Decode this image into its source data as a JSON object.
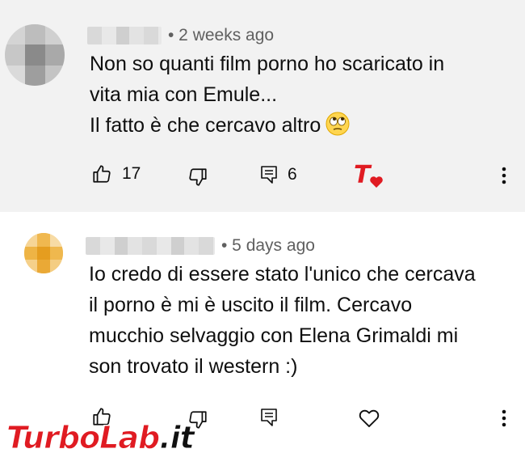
{
  "comments": [
    {
      "timestamp": "• 2 weeks ago",
      "text": "Non so quanti film porno ho scaricato in\nvita mia con Emule...\nIl fatto è che cercavo altro",
      "emoji": "face-with-rolling-eyes",
      "like_count": "17",
      "reply_count": "6",
      "creator_heart": true
    },
    {
      "timestamp": "• 5 days ago",
      "text": "Io credo di essere stato l'unico che cercava\nil porno è mi è uscito il film. Cercavo\nmucchio selvaggio con Elena Grimaldi mi\nson trovato il western :)",
      "like_count": "",
      "reply_count": "",
      "creator_heart": false
    }
  ],
  "watermark": {
    "part1": "TurboLab",
    "part2": ".it"
  },
  "colors": {
    "highlighted_comment_bg": "#f2f2f2",
    "text": "#0f0f0f",
    "meta_text": "#606060",
    "heart": "#e01b22"
  }
}
